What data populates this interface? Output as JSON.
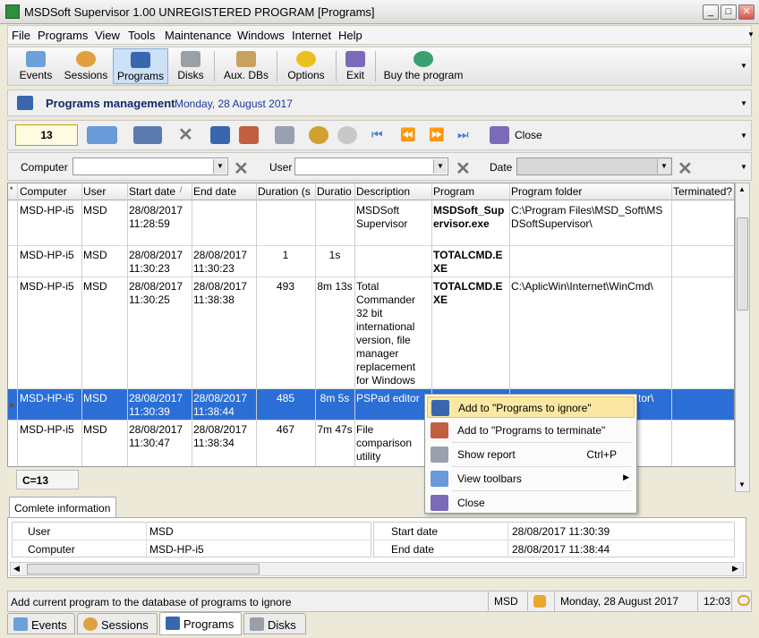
{
  "window": {
    "title": "MSDSoft Supervisor 1.00 UNREGISTERED PROGRAM [Programs]"
  },
  "menu": [
    "File",
    "Programs",
    "View",
    "Tools",
    "Maintenance",
    "Windows",
    "Internet",
    "Help"
  ],
  "toolbar": [
    {
      "label": "Events",
      "icon": "events-icon"
    },
    {
      "label": "Sessions",
      "icon": "sessions-icon"
    },
    {
      "label": "Programs",
      "icon": "programs-icon",
      "selected": true
    },
    {
      "label": "Disks",
      "icon": "disks-icon"
    },
    {
      "label": "Aux. DBs",
      "icon": "database-icon"
    },
    {
      "label": "Options",
      "icon": "options-icon"
    },
    {
      "label": "Exit",
      "icon": "exit-icon"
    },
    {
      "label": "Buy the program",
      "icon": "buy-icon"
    }
  ],
  "header": {
    "title": "Programs management",
    "date": "Monday, 28 August 2017"
  },
  "actions": {
    "count_value": "13",
    "close_label": "Close"
  },
  "filters": {
    "computer_label": "Computer",
    "user_label": "User",
    "date_label": "Date"
  },
  "grid": {
    "columns": [
      "Computer",
      "User",
      "Start date",
      "End date",
      "Duration (s",
      "Duratio",
      "Description",
      "Program",
      "Program folder",
      "Terminated?"
    ],
    "rows": [
      {
        "computer": "MSD-HP-i5",
        "user": "MSD",
        "start": "28/08/2017 11:28:59",
        "end": "",
        "dur_s": "",
        "dur": "",
        "desc": "MSDSoft Supervisor",
        "program": "MSDSoft_Supervisor.exe",
        "folder": "C:\\Program Files\\MSD_Soft\\MSDSoftSupervisor\\"
      },
      {
        "computer": "MSD-HP-i5",
        "user": "MSD",
        "start": "28/08/2017 11:30:23",
        "end": "28/08/2017 11:30:23",
        "dur_s": "1",
        "dur": "1s",
        "desc": "",
        "program": "TOTALCMD.EXE",
        "folder": ""
      },
      {
        "computer": "MSD-HP-i5",
        "user": "MSD",
        "start": "28/08/2017 11:30:25",
        "end": "28/08/2017 11:38:38",
        "dur_s": "493",
        "dur": "8m 13s",
        "desc": "Total Commander 32 bit international version, file manager replacement for Windows",
        "program": "TOTALCMD.EXE",
        "folder": "C:\\AplicWin\\Internet\\WinCmd\\"
      },
      {
        "computer": "MSD-HP-i5",
        "user": "MSD",
        "start": "28/08/2017 11:30:39",
        "end": "28/08/2017 11:38:44",
        "dur_s": "485",
        "dur": "8m 5s",
        "desc": "PSPad editor",
        "program": "",
        "folder": "tor\\",
        "selected": true
      },
      {
        "computer": "MSD-HP-i5",
        "user": "MSD",
        "start": "28/08/2017 11:30:47",
        "end": "28/08/2017 11:38:34",
        "dur_s": "467",
        "dur": "7m 47s",
        "desc": "File comparison utility",
        "program": "",
        "folder": ""
      }
    ]
  },
  "counter": "C=13",
  "info": {
    "tab": "Comlete information",
    "user_label": "User",
    "user": "MSD",
    "computer_label": "Computer",
    "computer": "MSD-HP-i5",
    "start_label": "Start date",
    "start": "28/08/2017 11:30:39",
    "end_label": "End date",
    "end": "28/08/2017 11:38:44"
  },
  "context_menu": [
    {
      "label": "Add to \"Programs to ignore\"",
      "icon": "add-ignore-icon",
      "hot": true
    },
    {
      "label": "Add to \"Programs to terminate\"",
      "icon": "add-terminate-icon"
    },
    {
      "label": "Show report",
      "shortcut": "Ctrl+P",
      "icon": "printer-icon"
    },
    {
      "label": "View toolbars",
      "submenu": true,
      "icon": "toolbars-icon"
    },
    {
      "label": "Close",
      "icon": "close-icon"
    }
  ],
  "status": {
    "message": "Add current program to the database of programs to ignore",
    "user": "MSD",
    "date": "Monday, 28 August 2017",
    "time": "12:03"
  },
  "tabs": [
    "Events",
    "Sessions",
    "Programs",
    "Disks"
  ]
}
